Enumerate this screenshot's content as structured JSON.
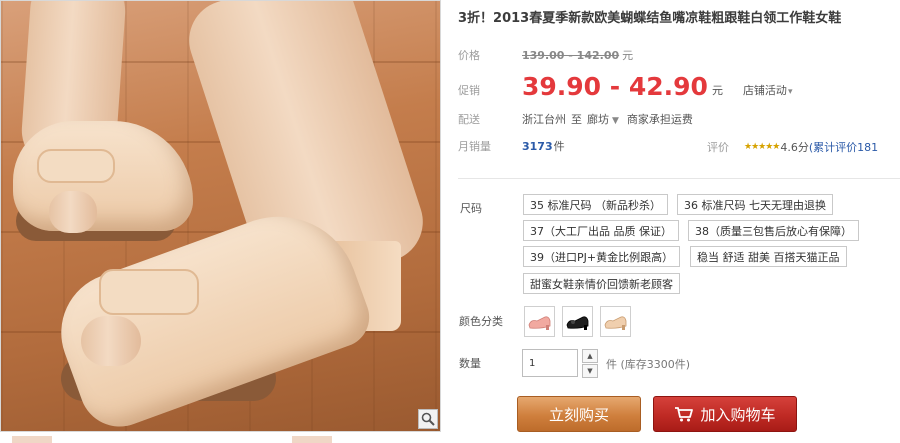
{
  "product": {
    "title": "3折！2013春夏季新款欧美蝴蝶结鱼嘴凉鞋粗跟鞋白领工作鞋女鞋"
  },
  "price": {
    "label": "价格",
    "original_range": "139.00 - 142.00",
    "unit": "元"
  },
  "promo": {
    "label": "促销",
    "price_range": "39.90 - 42.90",
    "unit": "元",
    "shop_event": "店铺活动"
  },
  "shipping": {
    "label": "配送",
    "from": "浙江台州",
    "to_word": "至",
    "destination": "廊坊",
    "fee_note": "商家承担运费"
  },
  "sales": {
    "label": "月销量",
    "count": "3173",
    "unit": "件"
  },
  "rating": {
    "label": "评价",
    "stars": "★★★★★",
    "score": "4.6分",
    "reviews_link": "(累计评价181"
  },
  "size": {
    "label": "尺码",
    "options": [
      "35 标准尺码 （新品秒杀）",
      "36 标准尺码 七天无理由退换",
      "37（大工厂出品 品质 保证）",
      "38（质量三包售后放心有保障）",
      "39（进口PJ+黄金比例跟高）",
      "稳当 舒适 甜美 百搭天猫正品",
      "甜蜜女鞋亲情价回馈新老顾客"
    ]
  },
  "color": {
    "label": "颜色分类",
    "swatches": [
      "pink-shoe-icon",
      "black-shoe-icon",
      "beige-shoe-icon"
    ]
  },
  "quantity": {
    "label": "数量",
    "value": "1",
    "stock": "件 (库存3300件)"
  },
  "actions": {
    "buy_now": "立刻购买",
    "add_to_cart": "加入购物车"
  },
  "colors": {
    "promo_price": "#e4393c",
    "buy_button": "#cf7f3d",
    "cart_button": "#bf2a24",
    "link": "#2b5aa8"
  }
}
